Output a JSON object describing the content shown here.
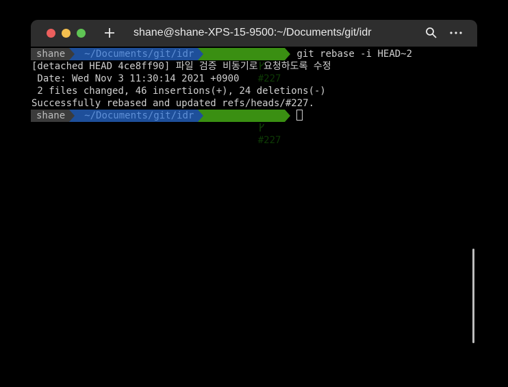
{
  "window": {
    "title": "shane@shane-XPS-15-9500:~/Documents/git/idr"
  },
  "prompt": {
    "user": "shane",
    "path": "~/Documents/git/idr",
    "branch": "#227",
    "branch_icon": "git-branch-icon"
  },
  "lines": {
    "command": "git rebase -i HEAD~2",
    "out1": "[detached HEAD 4ce8ff90] 파일 검증 비동기로 요청하도록 수정",
    "out2": " Date: Wed Nov 3 11:30:14 2021 +0900",
    "out3": " 2 files changed, 46 insertions(+), 24 deletions(-)",
    "out4": "Successfully rebased and updated refs/heads/#227."
  },
  "colors": {
    "close": "#ec5f5d",
    "minimize": "#f4bf4f",
    "maximize": "#5fc454",
    "segment_user": "#3b3b3b",
    "segment_path": "#1e4f9a",
    "segment_git": "#3a8f12"
  }
}
